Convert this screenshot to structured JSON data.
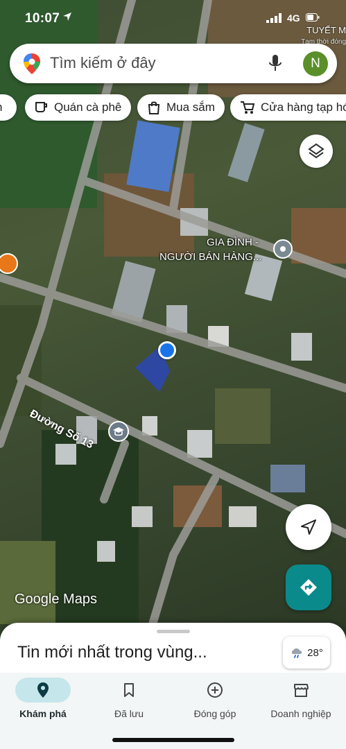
{
  "status_bar": {
    "time": "10:07",
    "network": "4G"
  },
  "top_place": {
    "name": "TUYẾT M",
    "subtitle": "Tạm thời đóng"
  },
  "search": {
    "placeholder": "Tìm kiếm ở đây",
    "avatar_initial": "N"
  },
  "chips": [
    {
      "label": "n",
      "icon": "partial-chip"
    },
    {
      "label": "Quán cà phê",
      "icon": "coffee-icon"
    },
    {
      "label": "Mua sắm",
      "icon": "shopping-bag-icon"
    },
    {
      "label": "Cửa hàng tạp hó",
      "icon": "cart-icon"
    }
  ],
  "map": {
    "place_label_line1": "GIA ĐÌNH -",
    "place_label_line2": "NGƯỜI BÁN HÀNG...",
    "street_label": "Đường Số 13",
    "logo": "Google Maps"
  },
  "sheet": {
    "title": "Tin mới nhất trong vùng...",
    "weather": "28°"
  },
  "nav": {
    "items": [
      {
        "label": "Khám phá",
        "icon": "explore-pin-icon",
        "active": true
      },
      {
        "label": "Đã lưu",
        "icon": "bookmark-icon",
        "active": false
      },
      {
        "label": "Đóng góp",
        "icon": "add-circle-icon",
        "active": false
      },
      {
        "label": "Doanh nghiệp",
        "icon": "storefront-icon",
        "active": false
      }
    ]
  },
  "colors": {
    "accent": "#1a73e8",
    "directions": "#0b8a8c",
    "nav_active": "#c5e6ea",
    "avatar": "#5a8f2a"
  }
}
